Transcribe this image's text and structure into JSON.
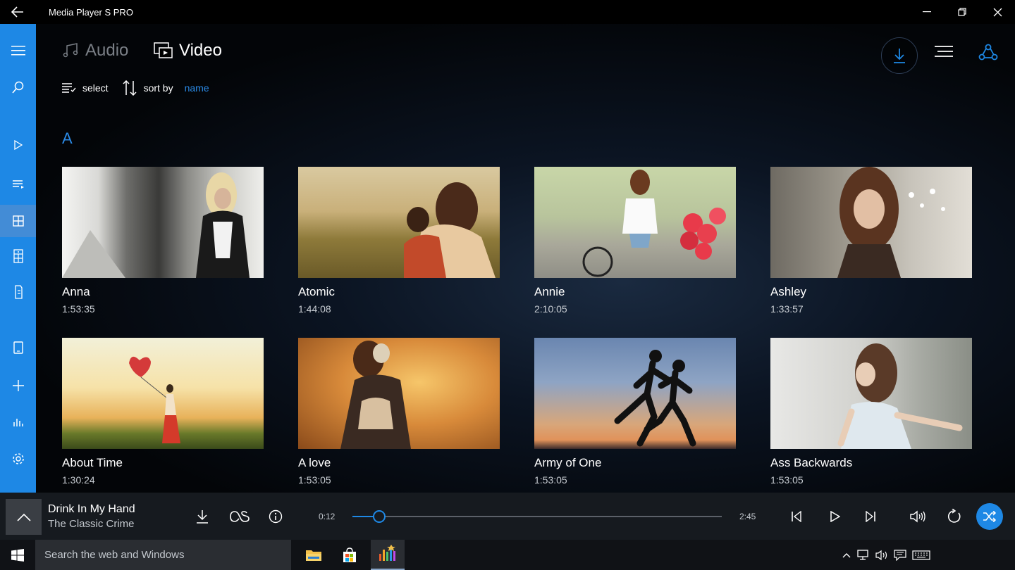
{
  "window": {
    "title": "Media Player S PRO"
  },
  "tabs": [
    {
      "label": "Audio",
      "active": false
    },
    {
      "label": "Video",
      "active": true
    }
  ],
  "toolbar": {
    "select_label": "select",
    "sort_label": "sort by",
    "sort_value": "name"
  },
  "section": {
    "letter": "A"
  },
  "videos": [
    {
      "title": "Anna",
      "duration": "1:53:35"
    },
    {
      "title": "Atomic",
      "duration": "1:44:08"
    },
    {
      "title": "Annie",
      "duration": "2:10:05"
    },
    {
      "title": "Ashley",
      "duration": "1:33:57"
    },
    {
      "title": "About Time",
      "duration": "1:30:24"
    },
    {
      "title": "A love",
      "duration": "1:53:05"
    },
    {
      "title": "Army of One",
      "duration": "1:53:05"
    },
    {
      "title": "Ass Backwards",
      "duration": "1:53:05"
    }
  ],
  "player": {
    "song": "Drink In My Hand",
    "artist": "The Classic Crime",
    "elapsed": "0:12",
    "total": "2:45",
    "progress": 0.0727
  },
  "taskbar": {
    "search_placeholder": "Search the web and Windows"
  },
  "colors": {
    "accent": "#1e88e5",
    "accent_text": "#2b8ae6",
    "sidebar": "#1e88e5"
  },
  "icons": {
    "sidebar": [
      "menu-icon",
      "search-icon",
      "play-icon",
      "playlist-icon",
      "grid-icon",
      "media-library-icon",
      "device-icon",
      "tablet-icon",
      "add-icon",
      "equalizer-icon",
      "settings-icon"
    ]
  }
}
